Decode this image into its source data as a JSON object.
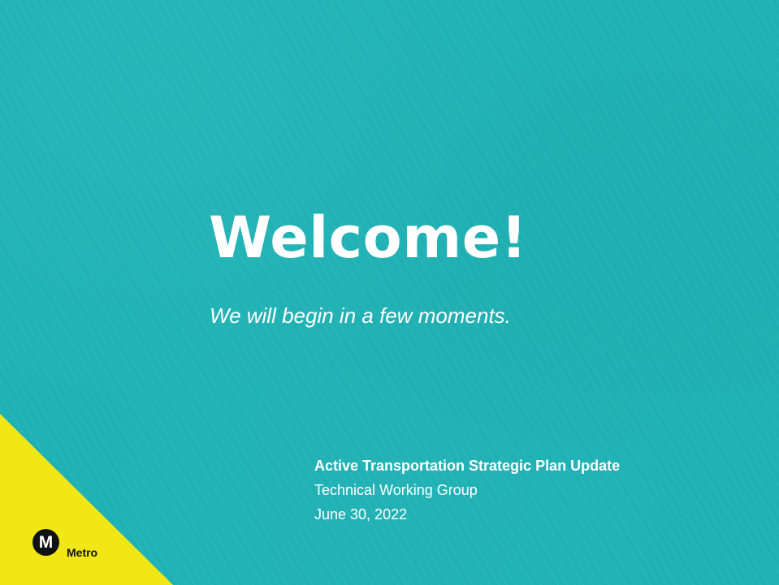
{
  "slide": {
    "title": "Welcome!",
    "subtitle": "We will begin in a few moments.",
    "plan_title": "Active Transportation Strategic Plan Update",
    "group": "Technical Working Group",
    "date": "June 30, 2022"
  },
  "logo": {
    "mark": "M",
    "wordmark": "Metro"
  },
  "colors": {
    "background": "#1fb2b4",
    "corner": "#f2e716",
    "text": "#ffffff"
  }
}
